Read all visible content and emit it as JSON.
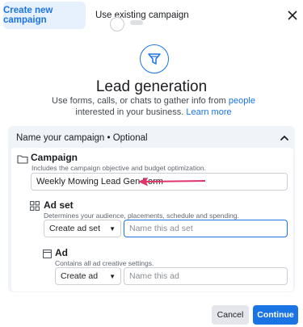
{
  "tabs": {
    "create_new": "Create new campaign",
    "use_existing": "Use existing campaign"
  },
  "icons": {
    "close": "close-icon",
    "objective": "funnel-icon",
    "collapse": "chevron-up-icon",
    "campaign": "folder-icon",
    "adset": "grid-icon",
    "ad": "ad-icon",
    "arrow": "arrow-annotation-icon"
  },
  "objective": {
    "title": "Lead generation",
    "description_pre": "Use forms, calls, or chats to gather info from ",
    "description_link1": "people",
    "description_mid": " interested in your business. ",
    "description_link2": "Learn more"
  },
  "section": {
    "header": "Name your campaign • Optional",
    "campaign": {
      "label": "Campaign",
      "sublabel": "Includes the campaign objective and budget optimization.",
      "value": "Weekly Mowing Lead Gen Form"
    },
    "adset": {
      "label": "Ad set",
      "sublabel": "Determines your audience, placements, schedule and spending.",
      "select_value": "Create ad set",
      "placeholder": "Name this ad set"
    },
    "ad": {
      "label": "Ad",
      "sublabel": "Contains all ad creative settings.",
      "select_value": "Create ad",
      "placeholder": "Name this ad"
    }
  },
  "footer": {
    "cancel": "Cancel",
    "continue": "Continue"
  },
  "colors": {
    "accent": "#1b74e4",
    "annotation_arrow": "#e0356a"
  }
}
